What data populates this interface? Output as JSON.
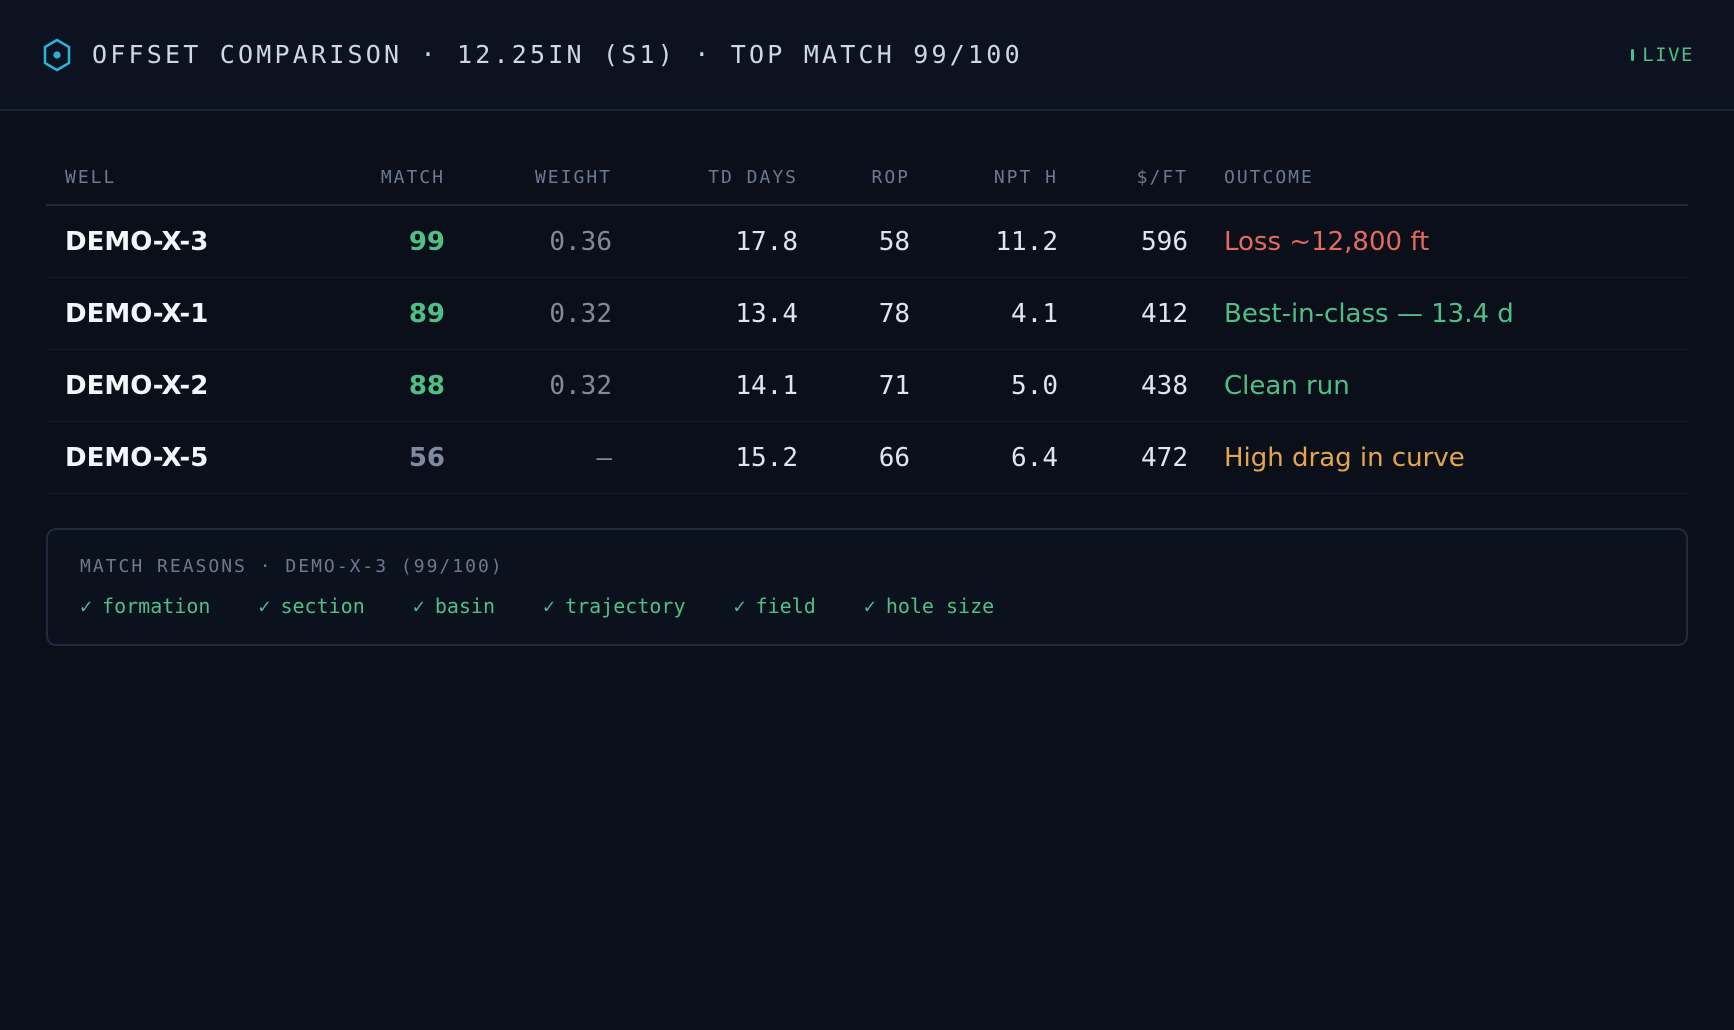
{
  "header": {
    "title": "OFFSET COMPARISON · 12.25IN (S1) · TOP MATCH 99/100",
    "live_label": "LIVE",
    "accent_color": "#2bb3d6",
    "live_color": "#4fbf87"
  },
  "table": {
    "columns": [
      "WELL",
      "MATCH",
      "WEIGHT",
      "TD DAYS",
      "ROP",
      "NPT H",
      "$/FT",
      "OUTCOME"
    ],
    "rows": [
      {
        "well": "DEMO-X-3",
        "match": "99",
        "weight": "0.36",
        "td_days": "17.8",
        "rop": "58",
        "npt_h": "11.2",
        "cost_ft": "596",
        "outcome": "Loss ~12,800 ft",
        "match_color": "#4fbf87",
        "outcome_color": "#e26a5f"
      },
      {
        "well": "DEMO-X-1",
        "match": "89",
        "weight": "0.32",
        "td_days": "13.4",
        "rop": "78",
        "npt_h": "4.1",
        "cost_ft": "412",
        "outcome": "Best-in-class — 13.4 d",
        "match_color": "#4fbf87",
        "outcome_color": "#4fbf87"
      },
      {
        "well": "DEMO-X-2",
        "match": "88",
        "weight": "0.32",
        "td_days": "14.1",
        "rop": "71",
        "npt_h": "5.0",
        "cost_ft": "438",
        "outcome": "Clean run",
        "match_color": "#4fbf87",
        "outcome_color": "#4fbf87"
      },
      {
        "well": "DEMO-X-5",
        "match": "56",
        "weight": "—",
        "td_days": "15.2",
        "rop": "66",
        "npt_h": "6.4",
        "cost_ft": "472",
        "outcome": "High drag in curve",
        "match_color": "#7f8aa0",
        "outcome_color": "#e3a64f"
      }
    ]
  },
  "match_reasons": {
    "title": "MATCH REASONS · DEMO-X-3 (99/100)",
    "check_glyph": "✓",
    "items": [
      "formation",
      "section",
      "basin",
      "trajectory",
      "field",
      "hole size"
    ]
  }
}
